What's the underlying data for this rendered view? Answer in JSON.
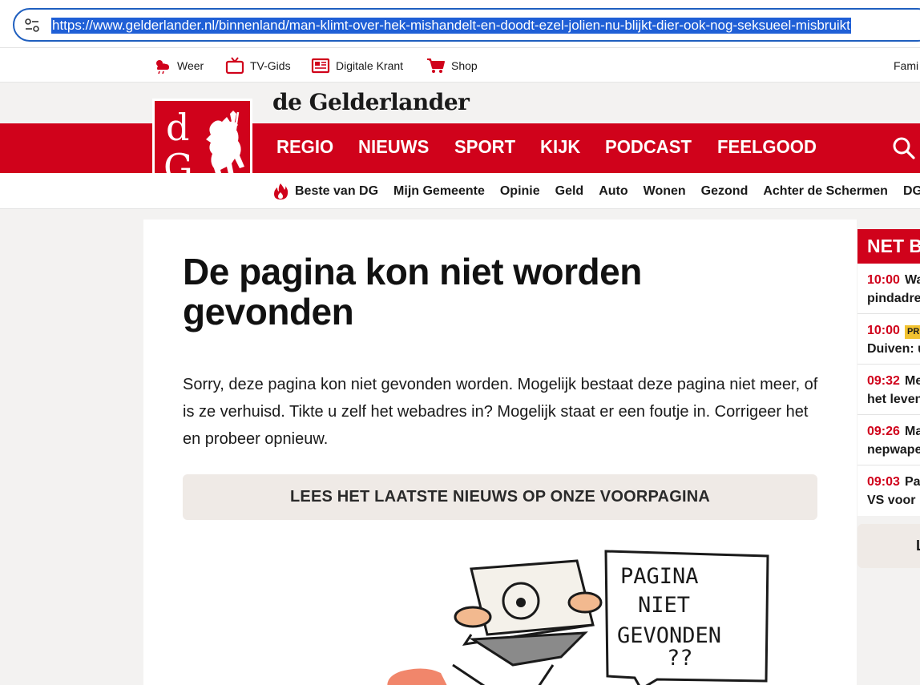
{
  "browser": {
    "url": "https://www.gelderlander.nl/binnenland/man-klimt-over-hek-mishandelt-en-doodt-ezel-jolien-nu-blijkt-dier-ook-nog-seksueel-misbruikt"
  },
  "utility": {
    "weer": "Weer",
    "tvgids": "TV-Gids",
    "krant": "Digitale Krant",
    "shop": "Shop",
    "familie": "Fami"
  },
  "brand": {
    "name": "de Gelderlander",
    "logo_d": "d",
    "logo_g": "G",
    "red": "#d0021b"
  },
  "nav": {
    "main": [
      "REGIO",
      "NIEUWS",
      "SPORT",
      "KIJK",
      "PODCAST",
      "FEELGOOD"
    ],
    "sub": [
      "Beste van DG",
      "Mijn Gemeente",
      "Opinie",
      "Geld",
      "Auto",
      "Wonen",
      "Gezond",
      "Achter de Schermen",
      "DG"
    ]
  },
  "content": {
    "title": "De pagina kon niet worden gevonden",
    "body": "Sorry, deze pagina kon niet gevonden worden. Mogelijk bestaat deze pagina niet meer, of is ze verhuisd. Tikte u zelf het webadres in? Mogelijk staat er een foutje in. Corrigeer het en probeer opnieuw.",
    "cta": "LEES HET LAATSTE NIEUWS OP ONZE VOORPAGINA",
    "bubble_lines": [
      "PAGINA",
      "NIET",
      "GEVONDEN",
      "??"
    ]
  },
  "sidebar": {
    "title": "NET B",
    "items": [
      {
        "time": "10:00",
        "head": "Wa",
        "sub": "pindadre",
        "badge": ""
      },
      {
        "time": "10:00",
        "head": "",
        "sub": "Duiven: u",
        "badge": "PR"
      },
      {
        "time": "09:32",
        "head": "Me",
        "sub": "het leven",
        "badge": ""
      },
      {
        "time": "09:26",
        "head": "Ma",
        "sub": "nepwape",
        "badge": ""
      },
      {
        "time": "09:03",
        "head": "Pa",
        "sub": "VS voor l",
        "badge": ""
      }
    ],
    "more": "L"
  }
}
